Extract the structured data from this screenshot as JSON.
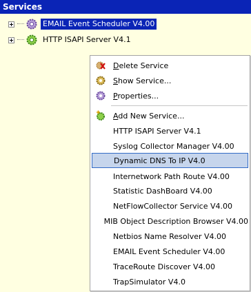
{
  "window": {
    "title": "Services"
  },
  "tree": {
    "items": [
      {
        "label": "EMAIL Event Scheduler V4.00",
        "selected": true
      },
      {
        "label": "HTTP ISAPI Server  V4.1",
        "selected": false
      }
    ]
  },
  "context_menu": {
    "actions": [
      {
        "pre": "",
        "key": "D",
        "rest": "elete Service",
        "icon": "delete-icon"
      },
      {
        "pre": "",
        "key": "S",
        "rest": "how Service...",
        "icon": "gear-icon"
      },
      {
        "pre": "",
        "key": "P",
        "rest": "roperties...",
        "icon": "gear-icon"
      },
      {
        "pre": "",
        "key": "A",
        "rest": "dd New Service...",
        "icon": "add-gear-icon"
      }
    ],
    "services": [
      "HTTP ISAPI Server  V4.1",
      "Syslog Collector Manager  V4.00",
      "Dynamic DNS To IP  V4.0",
      "Internetwork Path Route V4.00",
      "Statistic DashBoard V4.00",
      "NetFlowCollector Service  V4.00",
      "MIB Object Description Browser V4.00",
      "Netbios Name Resolver V4.00",
      "EMAIL Event Scheduler V4.00",
      "TraceRoute Discover V4.00",
      "TrapSimulator  V4.0"
    ],
    "highlighted_index": 2
  },
  "colors": {
    "title_bar": "#0a24b6",
    "background": "#ffffe1",
    "highlight": "#c6d5ec"
  }
}
